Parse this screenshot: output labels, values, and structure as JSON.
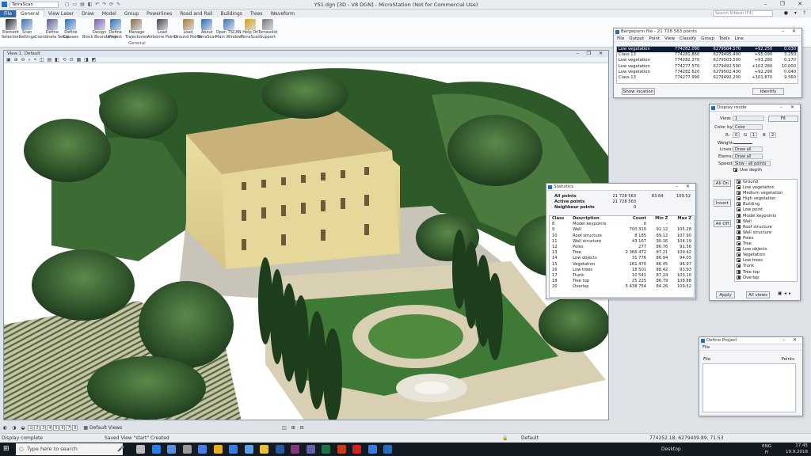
{
  "window": {
    "title": "YS1.dgn [3D - V8 DGN] - MicroStation (Not for Commercial Use)",
    "workspace": "TerraScan",
    "search_placeholder": "Search Ribbon (F4)",
    "controls": "–  ❐  ✕"
  },
  "ribbon": {
    "tabs": [
      "File",
      "General",
      "View Laser",
      "Draw",
      "Model",
      "Group",
      "Powerlines",
      "Road and Rail",
      "Buildings",
      "Trees",
      "Waveform"
    ],
    "active_tab": "General",
    "group_label": "General",
    "buttons": [
      {
        "label": "Element",
        "label2": "Selection",
        "icon": "arrow-cursor-icon"
      },
      {
        "label": "Scan",
        "label2": "Settings",
        "icon": "scan-settings-icon"
      },
      {
        "label": "Define",
        "label2": "Coordinate Setup",
        "icon": "coordinate-icon"
      },
      {
        "label": "Define",
        "label2": "Classes",
        "icon": "classes-icon"
      },
      {
        "label": "Design",
        "label2": "Block Boundaries",
        "icon": "block-icon"
      },
      {
        "label": "Define",
        "label2": "Project",
        "icon": "project-icon"
      },
      {
        "label": "Manage",
        "label2": "Trajectories",
        "icon": "trajectory-icon"
      },
      {
        "label": "Load",
        "label2": "Airborne Points",
        "icon": "airplane-icon"
      },
      {
        "label": "Load",
        "label2": "Ground Points",
        "icon": "ground-icon"
      },
      {
        "label": "About",
        "label2": "TerraScan",
        "icon": "info-icon"
      },
      {
        "label": "Open TSCAN",
        "label2": "Main Window",
        "icon": "window-icon"
      },
      {
        "label": "Help On",
        "label2": "TerraScan",
        "icon": "help-bulb-icon"
      },
      {
        "label": "Terrasolid",
        "label2": "Support",
        "icon": "wrench-icon"
      }
    ]
  },
  "view": {
    "title": "View 1, Default",
    "controls": "–  ❐  ✕",
    "tools": "▣ ⊕ ⊖ ⌕ ⌖ ◫ ▤ ◧ ⟲ ⊡ ▦ ◨ ◩"
  },
  "viewbar": {
    "numbers": [
      "1",
      "2",
      "3",
      "4",
      "5",
      "6",
      "7",
      "8"
    ],
    "views_label": "Default Views"
  },
  "statusbar": {
    "left": "Display complete",
    "message": "Saved View \"start\" Created",
    "level": "Default",
    "coords": "774252.18, 6279409.89, 71.53"
  },
  "taskbar": {
    "search": "Type here to search",
    "desktop": "Desktop",
    "time": "17.45",
    "date": "19.9.2018",
    "lang": "ENG",
    "region": "FI"
  },
  "points_dialog": {
    "title": "Bergepunn file - 21 728 563 points",
    "menu": [
      "File",
      "Output",
      "Point",
      "View",
      "Classify",
      "Group",
      "Tools",
      "Line"
    ],
    "rows": [
      [
        "Low vegetation",
        "774282.090",
        "6279504.570",
        "+92.250",
        "0.030"
      ],
      [
        "Class 13",
        "774281.860",
        "6279495.400",
        "+95.090",
        "3.250"
      ],
      [
        "Low vegetation",
        "774282.370",
        "6279503.500",
        "+93.280",
        "0.170"
      ],
      [
        "Low vegetation",
        "774277.570",
        "6279492.590",
        "+102.280",
        "10.000"
      ],
      [
        "Low vegetation",
        "774282.620",
        "6279502.430",
        "+92.290",
        "0.040"
      ],
      [
        "Class 13",
        "774277.990",
        "6279492.200",
        "+101.870",
        "9.560"
      ]
    ],
    "show_location": "Show location",
    "identify": "Identify"
  },
  "display_dialog": {
    "title": "Display mode",
    "view_label": "View:",
    "view_value": "1",
    "fit_label": "Fit",
    "color_label": "Color by:",
    "color_value": "Color",
    "r_label": "R:",
    "g_label": "G",
    "b_label": "B",
    "r_val": "0",
    "g_val": "1",
    "b_val": "2",
    "weight_label": "Weight:",
    "lines_label": "Lines:",
    "lines_value": "Draw all",
    "elems_label": "Elems:",
    "elems_value": "Draw all",
    "speed_label": "Speed:",
    "speed_value": "Slow - all points",
    "use_depth": "Use depth",
    "all_on": "All On",
    "invert": "Invert",
    "all_off": "All Off",
    "classes": [
      "Ground",
      "Low vegetation",
      "Medium vegetation",
      "High vegetation",
      "Building",
      "Low point",
      "Model keypoints",
      "Wall",
      "Roof structure",
      "Wall structure",
      "Poles",
      "Tree",
      "Low objects",
      "Vegetation",
      "Low trees",
      "Trunk",
      "Tree top",
      "Overlap"
    ],
    "apply": "Apply",
    "all_views": "All views"
  },
  "stats_dialog": {
    "title": "Statistics",
    "summary": [
      {
        "label": "All points",
        "count": "21 728 563",
        "min": "83.64",
        "max": "109.52"
      },
      {
        "label": "Active points",
        "count": "21 728 563",
        "min": "",
        "max": ""
      },
      {
        "label": "Neighbour points",
        "count": "0",
        "min": "",
        "max": ""
      }
    ],
    "headers": [
      "Class",
      "Description",
      "Count",
      "Min Z",
      "Max Z"
    ],
    "rows": [
      [
        "8",
        "Model keypoints",
        "0",
        "-",
        "-"
      ],
      [
        "9",
        "Wall",
        "700 310",
        "92.12",
        "105.28"
      ],
      [
        "10",
        "Roof structure",
        "8 185",
        "89.12",
        "107.90"
      ],
      [
        "11",
        "Wall structure",
        "43 167",
        "90.16",
        "104.19"
      ],
      [
        "12",
        "Poles",
        "277",
        "86.76",
        "91.56"
      ],
      [
        "13",
        "Tree",
        "2 366 472",
        "87.21",
        "109.42"
      ],
      [
        "14",
        "Low objects",
        "31 776",
        "86.94",
        "94.05"
      ],
      [
        "15",
        "Vegetation",
        "161 470",
        "86.45",
        "96.97"
      ],
      [
        "16",
        "Low trees",
        "18 501",
        "88.42",
        "93.93"
      ],
      [
        "17",
        "Trunk",
        "10 541",
        "87.24",
        "103.10"
      ],
      [
        "18",
        "Tree top",
        "25 225",
        "86.79",
        "108.88"
      ],
      [
        "20",
        "Overlap",
        "5 438 754",
        "84.26",
        "109.52"
      ]
    ]
  },
  "project_dialog": {
    "title": "Define Project",
    "menu": "File",
    "col_file": "File",
    "col_points": "Points"
  },
  "colors": {
    "accent": "#2b6bb5",
    "selected_row": "#0a1a3a",
    "taskbar": "#141a22"
  }
}
